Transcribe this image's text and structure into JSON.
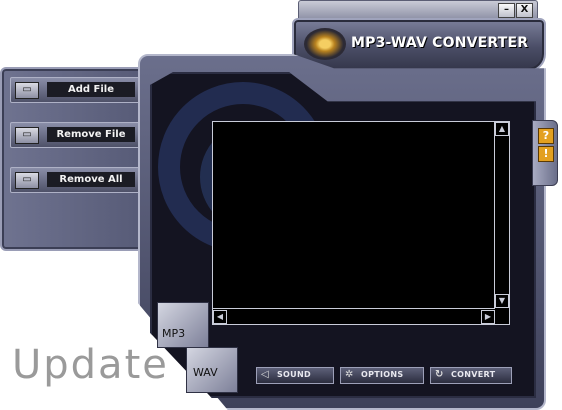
{
  "window": {
    "title": "MP3-WAV CONVERTER",
    "minimize_glyph": "–",
    "close_glyph": "X"
  },
  "sidebar": {
    "items": [
      {
        "label": "Add File",
        "icon": "folder-add-icon"
      },
      {
        "label": "Remove File",
        "icon": "folder-remove-icon"
      },
      {
        "label": "Remove All",
        "icon": "folder-clear-icon"
      }
    ]
  },
  "help": {
    "question": "?",
    "info": "!"
  },
  "modes": {
    "mp3": "MP3",
    "wav": "WAV"
  },
  "actions": {
    "sound": "SOUND",
    "options": "OPTIONS",
    "convert": "CONVERT"
  },
  "watermark": "Update"
}
